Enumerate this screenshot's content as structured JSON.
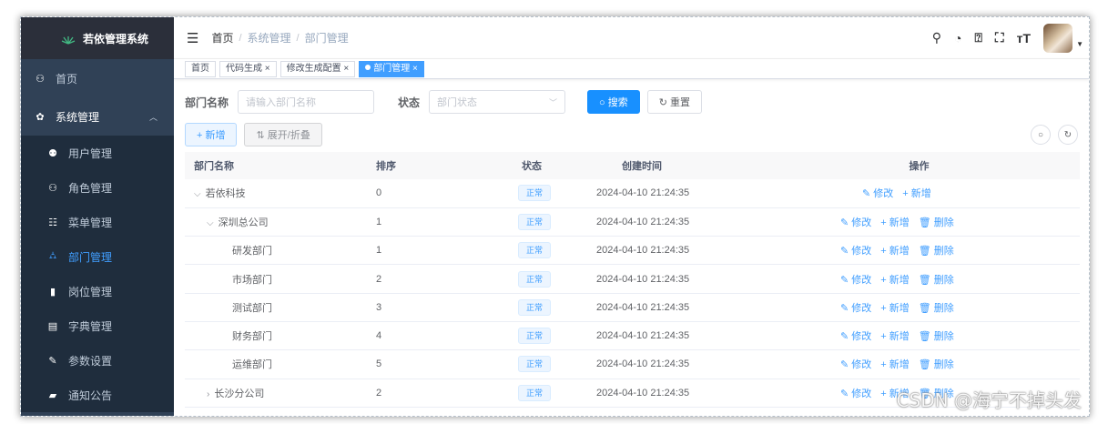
{
  "app": {
    "title": "若依管理系统"
  },
  "sidebar": {
    "items": [
      {
        "label": "首页",
        "icon": "dashboard-icon",
        "glyph": "⚇"
      },
      {
        "label": "系统管理",
        "icon": "gear-icon",
        "glyph": "✿"
      },
      {
        "label": "用户管理",
        "icon": "user-icon",
        "glyph": "⚉"
      },
      {
        "label": "角色管理",
        "icon": "peoples-icon",
        "glyph": "⚇"
      },
      {
        "label": "菜单管理",
        "icon": "tree-table-icon",
        "glyph": "☷"
      },
      {
        "label": "部门管理",
        "icon": "tree-icon",
        "glyph": "⛼"
      },
      {
        "label": "岗位管理",
        "icon": "post-icon",
        "glyph": "▮"
      },
      {
        "label": "字典管理",
        "icon": "dict-icon",
        "glyph": "▤"
      },
      {
        "label": "参数设置",
        "icon": "edit-icon",
        "glyph": "✎"
      },
      {
        "label": "通知公告",
        "icon": "message-icon",
        "glyph": "▰"
      }
    ]
  },
  "breadcrumb": {
    "home": "首页",
    "sep": "/",
    "level1": "系统管理",
    "level2": "部门管理"
  },
  "tags": [
    {
      "label": "首页"
    },
    {
      "label": "代码生成 ×"
    },
    {
      "label": "修改生成配置 ×"
    },
    {
      "label": "部门管理 ×"
    }
  ],
  "search": {
    "dept_label": "部门名称",
    "dept_placeholder": "请输入部门名称",
    "status_label": "状态",
    "status_placeholder": "部门状态",
    "search_btn": "○ 搜索",
    "reset_btn": "↻ 重置"
  },
  "toolbar": {
    "add": "+ 新增",
    "expand": "⇅ 展开/折叠"
  },
  "table": {
    "headers": [
      "部门名称",
      "排序",
      "状态",
      "创建时间",
      "操作"
    ],
    "rows": [
      {
        "name": "若依科技",
        "arrow": "⌵",
        "order": "0",
        "status": "正常",
        "time": "2024-04-10 21:24:35",
        "ops": [
          "✎ 修改",
          "+ 新增"
        ]
      },
      {
        "name": "深圳总公司",
        "arrow": "⌵",
        "order": "1",
        "status": "正常",
        "time": "2024-04-10 21:24:35",
        "ops": [
          "✎ 修改",
          "+ 新增",
          "🗑 删除"
        ]
      },
      {
        "name": "研发部门",
        "arrow": "",
        "order": "1",
        "status": "正常",
        "time": "2024-04-10 21:24:35",
        "ops": [
          "✎ 修改",
          "+ 新增",
          "🗑 删除"
        ]
      },
      {
        "name": "市场部门",
        "arrow": "",
        "order": "2",
        "status": "正常",
        "time": "2024-04-10 21:24:35",
        "ops": [
          "✎ 修改",
          "+ 新增",
          "🗑 删除"
        ]
      },
      {
        "name": "测试部门",
        "arrow": "",
        "order": "3",
        "status": "正常",
        "time": "2024-04-10 21:24:35",
        "ops": [
          "✎ 修改",
          "+ 新增",
          "🗑 删除"
        ]
      },
      {
        "name": "财务部门",
        "arrow": "",
        "order": "4",
        "status": "正常",
        "time": "2024-04-10 21:24:35",
        "ops": [
          "✎ 修改",
          "+ 新增",
          "🗑 删除"
        ]
      },
      {
        "name": "运维部门",
        "arrow": "",
        "order": "5",
        "status": "正常",
        "time": "2024-04-10 21:24:35",
        "ops": [
          "✎ 修改",
          "+ 新增",
          "🗑 删除"
        ]
      },
      {
        "name": "长沙分公司",
        "arrow": "›",
        "order": "2",
        "status": "正常",
        "time": "2024-04-10 21:24:35",
        "ops": [
          "✎ 修改",
          "+ 新增",
          "🗑 删除"
        ]
      }
    ]
  },
  "watermark": "CSDN @海宁不掉头发",
  "colors": {
    "sidebar_bg": "#304156",
    "primary": "#409eff",
    "active_tag": "#409eff"
  }
}
